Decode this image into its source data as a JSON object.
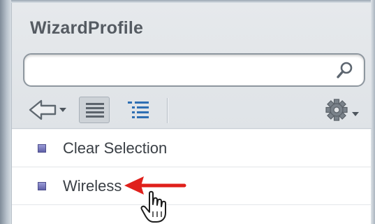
{
  "panel": {
    "title": "WizardProfile"
  },
  "search": {
    "value": "",
    "placeholder": "",
    "icon": "magnifier-icon"
  },
  "toolbar": {
    "back": {
      "icon": "back-arrow-icon",
      "has_dropdown": true
    },
    "list_view": {
      "icon": "list-view-icon",
      "selected": true
    },
    "detail_view": {
      "icon": "detail-list-icon"
    },
    "settings": {
      "icon": "gear-icon",
      "has_dropdown": true
    }
  },
  "list": {
    "items": [
      {
        "label": "Clear Selection"
      },
      {
        "label": "Wireless"
      }
    ]
  },
  "annotations": {
    "arrow_color": "#e0201b",
    "cursor": "hand-pointer-icon"
  }
}
